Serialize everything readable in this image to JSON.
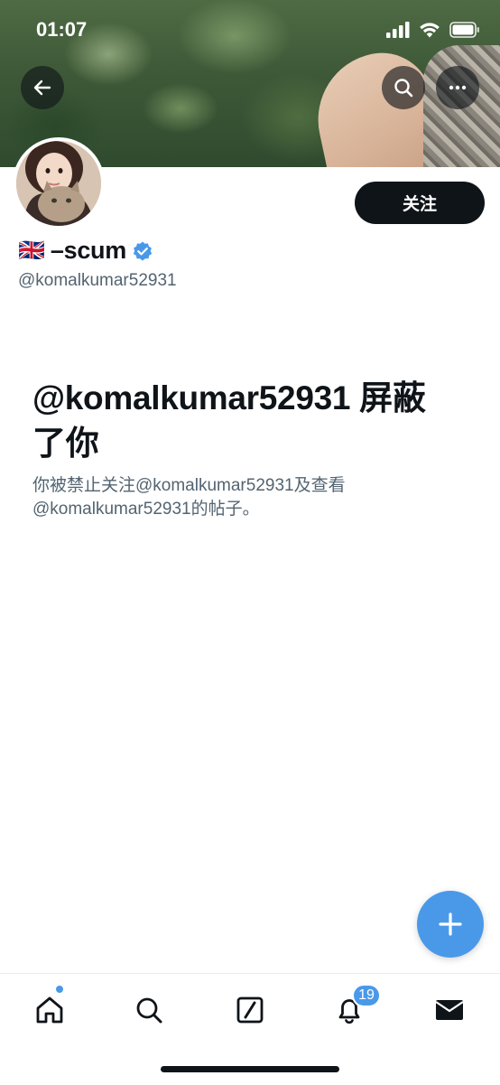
{
  "status_bar": {
    "time": "01:07"
  },
  "header": {
    "back_icon": "arrow-left-icon",
    "search_icon": "search-icon",
    "more_icon": "ellipsis-icon"
  },
  "profile": {
    "flag": "🇬🇧",
    "display_name": "–scum",
    "verified_icon": "verified-badge-icon",
    "handle": "@komalkumar52931",
    "follow_label": "关注"
  },
  "blocked": {
    "title": "@komalkumar52931 屏蔽了你",
    "description": "你被禁止关注@komalkumar52931及查看@komalkumar52931的帖子。"
  },
  "tabbar": {
    "items": [
      {
        "name": "home",
        "icon": "home-icon"
      },
      {
        "name": "search",
        "icon": "search-icon"
      },
      {
        "name": "grok",
        "icon": "grok-icon"
      },
      {
        "name": "notifications",
        "icon": "bell-icon"
      },
      {
        "name": "messages",
        "icon": "mail-icon"
      }
    ],
    "notification_count": "19"
  },
  "colors": {
    "accent": "#4a99e9",
    "text_primary": "#0f1419",
    "text_secondary": "#536471"
  }
}
